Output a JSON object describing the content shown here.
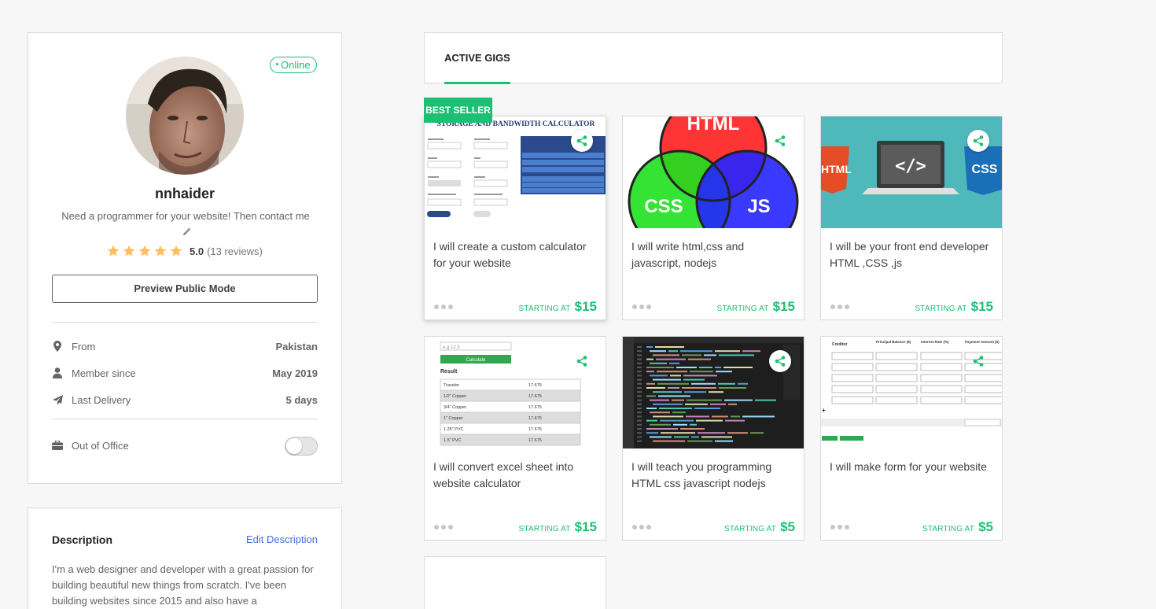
{
  "profile": {
    "online_label": "Online",
    "username": "nnhaider",
    "tagline": "Need a programmer for your website! Then contact me",
    "rating_score": "5.0",
    "review_count": "(13 reviews)",
    "stars": 5,
    "preview_button": "Preview Public Mode",
    "stats": [
      {
        "icon": "location-pin-icon",
        "label": "From",
        "value": "Pakistan"
      },
      {
        "icon": "user-icon",
        "label": "Member since",
        "value": "May 2019"
      },
      {
        "icon": "paper-plane-icon",
        "label": "Last Delivery",
        "value": "5 days"
      }
    ],
    "out_of_office_label": "Out of Office",
    "out_of_office_enabled": false
  },
  "description": {
    "title": "Description",
    "edit_label": "Edit Description",
    "text": "I'm a web designer and developer with a great passion for building beautiful new things from scratch. I've been building websites since 2015 and also have a"
  },
  "tabs": {
    "active": "ACTIVE GIGS"
  },
  "badge": {
    "best_seller": "BEST SELLER"
  },
  "gigs": [
    {
      "title": "I will create a custom calculator for your website",
      "starting_label": "STARTING AT",
      "price": "$15",
      "thumb_title": "STORAGE AND BANDWIDTH CALCULATOR"
    },
    {
      "title": "I will write html,css and javascript, nodejs",
      "starting_label": "STARTING AT",
      "price": "$15",
      "thumb_labels": [
        "HTML",
        "CSS",
        "JS"
      ]
    },
    {
      "title": "I will be your front end developer HTML ,CSS ,js",
      "starting_label": "STARTING AT",
      "price": "$15",
      "thumb_labels": [
        "HTML",
        "</>",
        "CSS"
      ]
    },
    {
      "title": "I will convert excel sheet into website calculator",
      "starting_label": "STARTING AT",
      "price": "$15",
      "thumb_heading": "Result",
      "thumb_button": "Calculate",
      "thumb_input": "e.g 12.5",
      "thumb_rows": [
        "Traveler",
        "1/2\" Copper",
        "3/4\" Copper",
        "1\" Copper",
        "1.25\" PVC",
        "1.5\" PVC"
      ],
      "thumb_value": "17.675"
    },
    {
      "title": "I will teach you programming HTML css javascript nodejs",
      "starting_label": "STARTING AT",
      "price": "$5"
    },
    {
      "title": "I will make form for your website",
      "starting_label": "STARTING AT",
      "price": "$5",
      "thumb_cols": [
        "Creditor",
        "Principal Balance ($)",
        "Interest Rate (%)",
        "Payment Amount ($)"
      ]
    }
  ],
  "colors": {
    "accent": "#1dbf73",
    "link": "#446ee7",
    "star": "#ffbe5b"
  }
}
